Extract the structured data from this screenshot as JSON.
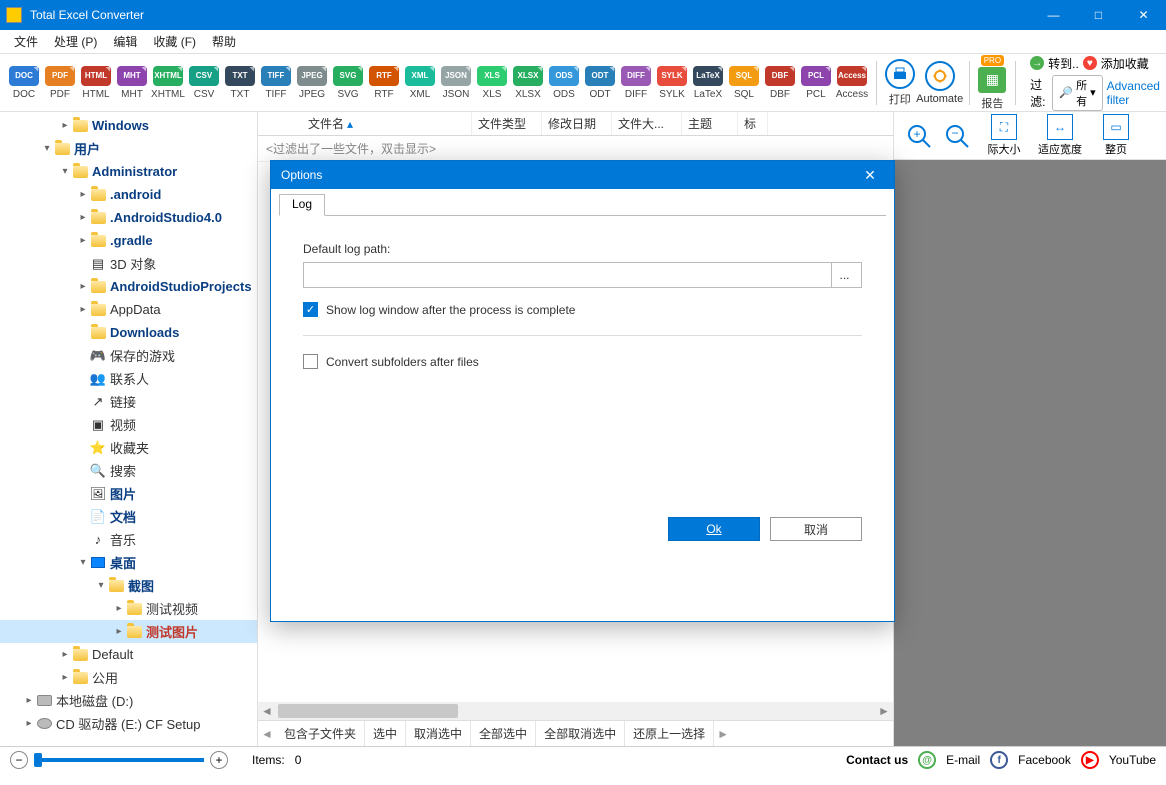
{
  "app": {
    "title": "Total Excel Converter"
  },
  "window": {
    "min": "—",
    "max": "□",
    "close": "✕"
  },
  "menu": [
    "文件",
    "处理 (P)",
    "编辑",
    "收藏 (F)",
    "帮助"
  ],
  "formats": [
    {
      "code": "DOC",
      "color": "#2e7bd6"
    },
    {
      "code": "PDF",
      "color": "#e67e22"
    },
    {
      "code": "HTML",
      "color": "#c0392b"
    },
    {
      "code": "MHT",
      "color": "#8e44ad"
    },
    {
      "code": "XHTML",
      "color": "#27ae60"
    },
    {
      "code": "CSV",
      "color": "#16a085"
    },
    {
      "code": "TXT",
      "color": "#34495e"
    },
    {
      "code": "TIFF",
      "color": "#2980b9"
    },
    {
      "code": "JPEG",
      "color": "#7f8c8d"
    },
    {
      "code": "SVG",
      "color": "#27ae60"
    },
    {
      "code": "RTF",
      "color": "#d35400"
    },
    {
      "code": "XML",
      "color": "#1abc9c"
    },
    {
      "code": "JSON",
      "color": "#95a5a6"
    },
    {
      "code": "XLS",
      "color": "#2ecc71"
    },
    {
      "code": "XLSX",
      "color": "#27ae60"
    },
    {
      "code": "ODS",
      "color": "#3498db"
    },
    {
      "code": "ODT",
      "color": "#2980b9"
    },
    {
      "code": "DIFF",
      "color": "#9b59b6"
    },
    {
      "code": "SYLK",
      "color": "#e74c3c"
    },
    {
      "code": "LaTeX",
      "color": "#34495e"
    },
    {
      "code": "SQL",
      "color": "#f39c12"
    },
    {
      "code": "DBF",
      "color": "#c0392b"
    },
    {
      "code": "PCL",
      "color": "#8e44ad"
    },
    {
      "code": "Access",
      "color": "#c0392b"
    }
  ],
  "bigbuttons": {
    "print": "打印",
    "automate": "Automate",
    "report": "报告",
    "pro": "PRO"
  },
  "filter": {
    "goto": "转到..",
    "favorite": "添加收藏",
    "label": "过滤:",
    "all": "所有",
    "advanced": "Advanced filter"
  },
  "tree": [
    {
      "depth": 3,
      "label": "Windows",
      "exp": "▸",
      "cls": "bold",
      "icon": "folder"
    },
    {
      "depth": 2,
      "label": "用户",
      "exp": "▾",
      "cls": "bold",
      "icon": "folder"
    },
    {
      "depth": 3,
      "label": "Administrator",
      "exp": "▾",
      "cls": "bold",
      "icon": "folder"
    },
    {
      "depth": 4,
      "label": ".android",
      "exp": "▸",
      "cls": "bold",
      "icon": "folder"
    },
    {
      "depth": 4,
      "label": ".AndroidStudio4.0",
      "exp": "▸",
      "cls": "bold",
      "icon": "folder"
    },
    {
      "depth": 4,
      "label": ".gradle",
      "exp": "▸",
      "cls": "bold",
      "icon": "folder"
    },
    {
      "depth": 4,
      "label": "3D 对象",
      "exp": "",
      "cls": "",
      "icon": "cube"
    },
    {
      "depth": 4,
      "label": "AndroidStudioProjects",
      "exp": "▸",
      "cls": "bold",
      "icon": "folder"
    },
    {
      "depth": 4,
      "label": "AppData",
      "exp": "▸",
      "cls": "",
      "icon": "folder"
    },
    {
      "depth": 4,
      "label": "Downloads",
      "exp": "",
      "cls": "bold",
      "icon": "folder"
    },
    {
      "depth": 4,
      "label": "保存的游戏",
      "exp": "",
      "cls": "",
      "icon": "game"
    },
    {
      "depth": 4,
      "label": "联系人",
      "exp": "",
      "cls": "",
      "icon": "contact"
    },
    {
      "depth": 4,
      "label": "链接",
      "exp": "",
      "cls": "",
      "icon": "link"
    },
    {
      "depth": 4,
      "label": "视频",
      "exp": "",
      "cls": "",
      "icon": "video"
    },
    {
      "depth": 4,
      "label": "收藏夹",
      "exp": "",
      "cls": "",
      "icon": "star"
    },
    {
      "depth": 4,
      "label": "搜索",
      "exp": "",
      "cls": "",
      "icon": "search"
    },
    {
      "depth": 4,
      "label": "图片",
      "exp": "",
      "cls": "bold",
      "icon": "pic"
    },
    {
      "depth": 4,
      "label": "文档",
      "exp": "",
      "cls": "bold",
      "icon": "doc"
    },
    {
      "depth": 4,
      "label": "音乐",
      "exp": "",
      "cls": "",
      "icon": "music"
    },
    {
      "depth": 4,
      "label": "桌面",
      "exp": "▾",
      "cls": "bold",
      "icon": "desk"
    },
    {
      "depth": 5,
      "label": "截图",
      "exp": "▾",
      "cls": "bold",
      "icon": "folder"
    },
    {
      "depth": 6,
      "label": "测试视频",
      "exp": "▸",
      "cls": "",
      "icon": "folder"
    },
    {
      "depth": 6,
      "label": "测试图片",
      "exp": "▸",
      "cls": "red",
      "icon": "folder",
      "sel": true
    },
    {
      "depth": 3,
      "label": "Default",
      "exp": "▸",
      "cls": "",
      "icon": "folder"
    },
    {
      "depth": 3,
      "label": "公用",
      "exp": "▸",
      "cls": "",
      "icon": "folder"
    },
    {
      "depth": 1,
      "label": "本地磁盘 (D:)",
      "exp": "▸",
      "cls": "",
      "icon": "drive"
    },
    {
      "depth": 1,
      "label": "CD 驱动器 (E:) CF Setup",
      "exp": "▸",
      "cls": "",
      "icon": "cd"
    }
  ],
  "list": {
    "columns": [
      "文件名",
      "文件类型",
      "修改日期",
      "文件大...",
      "主题",
      "标"
    ],
    "filtermsg": "<过滤出了一些文件，双击显示>"
  },
  "bottomtabs": {
    "left_arrow": "◄",
    "right_arrow": "►",
    "items": [
      "包含子文件夹",
      "选中",
      "取消选中",
      "全部选中",
      "全部取消选中",
      "还原上一选择"
    ]
  },
  "view": {
    "zoomin": "+",
    "zoomout": "−",
    "actual": "际大小",
    "fitwidth": "适应宽度",
    "full": "整页"
  },
  "status": {
    "items_label": "Items:",
    "items_count": "0",
    "contact": "Contact us",
    "email": "E-mail",
    "facebook": "Facebook",
    "youtube": "YouTube"
  },
  "modal": {
    "title": "Options",
    "tab": "Log",
    "default_log_label": "Default log path:",
    "log_path_value": "",
    "browse": "...",
    "chk1": "Show log window after the process is complete",
    "chk2": "Convert subfolders after files",
    "ok": "Ok",
    "cancel": "取消",
    "close": "✕"
  }
}
